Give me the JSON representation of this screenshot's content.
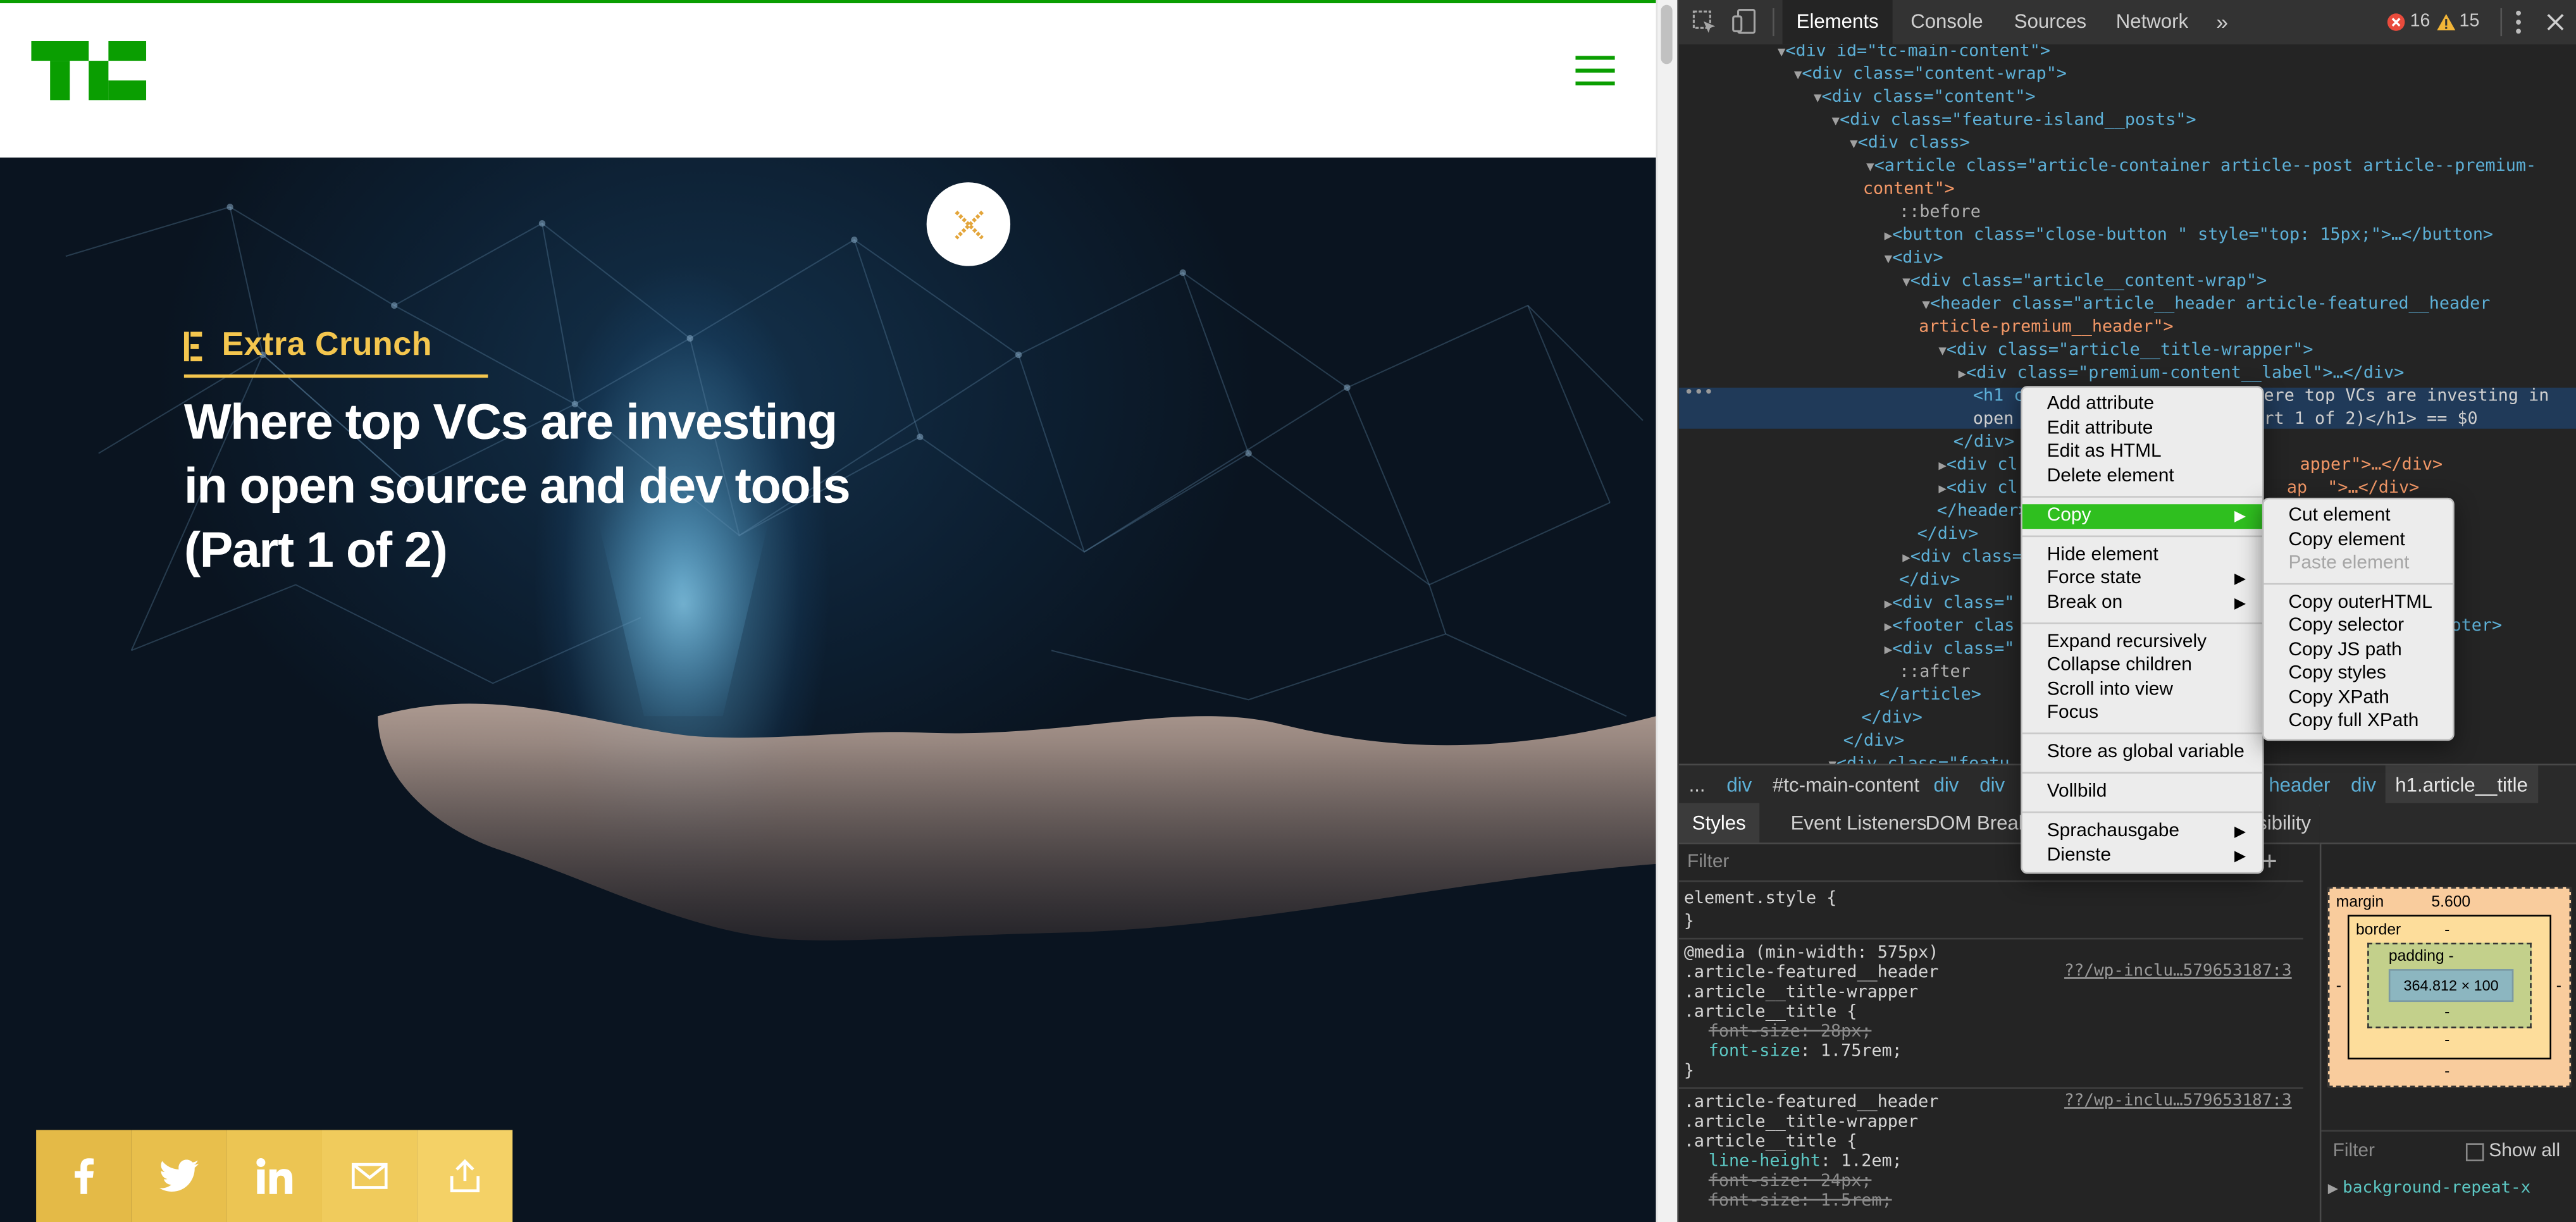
{
  "page": {
    "site_logo_text": "TC",
    "kicker": "Extra Crunch",
    "title_lines": [
      "Where top VCs are investing",
      "in open source and dev tools",
      "(Part 1 of 2)"
    ],
    "share_icons": [
      "facebook-icon",
      "twitter-icon",
      "linkedin-icon",
      "mail-icon",
      "share-icon"
    ],
    "colors": {
      "brand_green": "#0a9e01",
      "kicker_gold": "#f4c64e",
      "share_bg": [
        "#e4ba47",
        "#e8bf4c",
        "#ecc553",
        "#f0cb5c",
        "#f4d166"
      ]
    }
  },
  "devtools": {
    "tabs": [
      "Elements",
      "Console",
      "Sources",
      "Network",
      "»"
    ],
    "errors": "16",
    "warnings": "15",
    "tree": [
      {
        "text": "<div id=\"tc-main-content\">"
      },
      {
        "text": "<div class=\"content-wrap\">"
      },
      {
        "text": "<div class=\"content\">"
      },
      {
        "text": "<div class=\"feature-island__posts\">"
      },
      {
        "text": "<div class>"
      },
      {
        "text": "<article class=\"article-container article--post article--premium-"
      },
      {
        "text": "content\">"
      },
      {
        "text": "::before"
      },
      {
        "text": "<button class=\"close-button \" style=\"top: 15px;\">…</button>"
      },
      {
        "text": "<div>"
      },
      {
        "text": "<div class=\"article__content-wrap\">"
      },
      {
        "text": "<header class=\"article__header article-featured__header"
      },
      {
        "text": "article-premium__header\">"
      },
      {
        "text": "<div class=\"article__title-wrapper\">"
      },
      {
        "text": "<div class=\"premium-content__label\">…</div>"
      },
      {
        "text": "<h1 c"
      },
      {
        "text": "open"
      },
      {
        "text": "</div>"
      },
      {
        "text": "<div cl"
      },
      {
        "text": "<div cl"
      },
      {
        "text": "</header>"
      },
      {
        "text": "</div>"
      },
      {
        "text": "<div class="
      },
      {
        "text": "</div>"
      },
      {
        "text": "<div class=\""
      },
      {
        "text": "<footer clas"
      },
      {
        "text": "<div class=\""
      },
      {
        "text": "::after"
      },
      {
        "text": "</article>"
      },
      {
        "text": "</div>"
      },
      {
        "text": "</div>"
      },
      {
        "text": "<div class=\"featu"
      }
    ],
    "tree_right": {
      "sel1": "ere top VCs are investing in",
      "sel2": "rt 1 of 2)</h1> == $0",
      "r1": "apper\">…</div>",
      "r2": "ap  \">…</div>",
      "r3": "oter>"
    },
    "breadcrumbs": [
      "...",
      "div",
      "#tc-main-content",
      "div",
      "div",
      "header",
      "div",
      "h1.article__title"
    ],
    "sub_tabs": [
      "Styles",
      "Event Listeners",
      "DOM Break",
      "sibility"
    ],
    "styles": {
      "filter_placeholder": "Filter",
      "element_style": "element.style {",
      "close": "}",
      "media": "@media (min-width: 575px)",
      "sel1": ".article-featured__header",
      "sel2": ".article__title-wrapper",
      "sel3": ".article__title {",
      "p1_name": "font-size",
      "p1_val": "28px;",
      "p2_name": "font-size",
      "p2_val": "1.75rem;",
      "link": "??/wp-inclu…579653187:3",
      "sel4": ".article-featured__header",
      "sel5": ".article__title-wrapper",
      "sel6": ".article__title {",
      "p3_name": "line-height",
      "p3_val": "1.2em;",
      "p4_name": "font-size",
      "p4_val": "24px;",
      "p5_name": "font-size",
      "p5_val": "1.5rem;"
    },
    "box_model": {
      "margin_label": "margin",
      "margin_val": "5.600",
      "border_label": "border",
      "padding_label": "padding -",
      "content": "364.812 × 100",
      "dash": "-",
      "filter_placeholder": "Filter",
      "show_all": "Show all",
      "computed_item": "background-repeat-x"
    },
    "context_menu": {
      "items1": [
        "Add attribute",
        "Edit attribute",
        "Edit as HTML",
        "Delete element"
      ],
      "copy": "Copy",
      "items2": [
        "Hide element",
        "Force state",
        "Break on"
      ],
      "items3": [
        "Expand recursively",
        "Collapse children",
        "Scroll into view",
        "Focus"
      ],
      "store": "Store as global variable",
      "vollbild": "Vollbild",
      "items4": [
        "Sprachausgabe",
        "Dienste"
      ]
    },
    "copy_submenu": {
      "group1": [
        "Cut element",
        "Copy element",
        "Paste element"
      ],
      "group2": [
        "Copy outerHTML",
        "Copy selector",
        "Copy JS path",
        "Copy styles",
        "Copy XPath",
        "Copy full XPath"
      ]
    }
  }
}
